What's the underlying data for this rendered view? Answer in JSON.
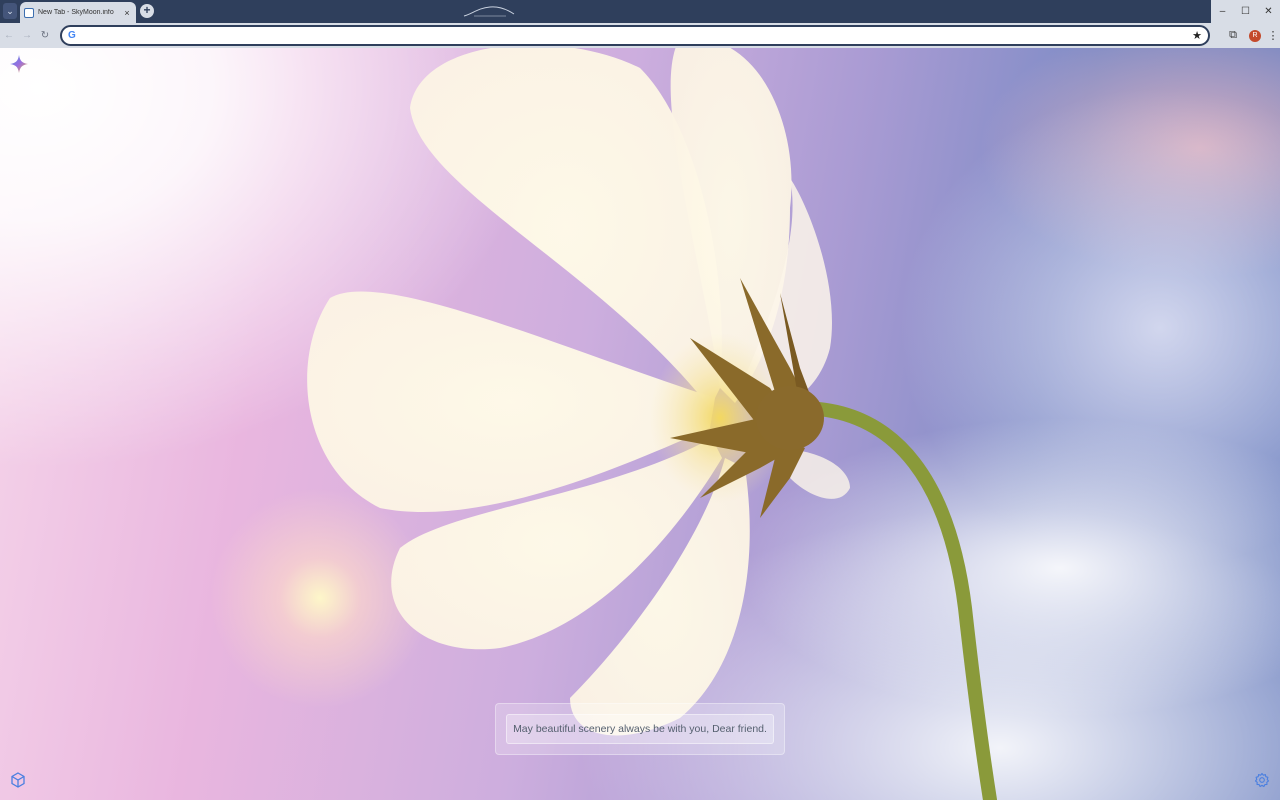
{
  "browser": {
    "tab": {
      "title": "New Tab - SkyMoon.info",
      "close": "×"
    },
    "new_tab": "+",
    "window_controls": {
      "minimize": "–",
      "maximize": "☐",
      "close": "✕"
    },
    "toolbar": {
      "back": "←",
      "forward": "→",
      "reload": "↻",
      "omnibox_value": "",
      "google_glyph": "G",
      "star": "★",
      "extensions": "⧉",
      "avatar_letter": "R",
      "menu": "⋮"
    },
    "tab_search": "⌄"
  },
  "page": {
    "quote": "May beautiful scenery always be with you, Dear friend."
  },
  "colors": {
    "frame": "#2f3f5c",
    "toolbar": "#d8dde6",
    "avatar": "#c44a2c",
    "accent_icon": "#4a7fe0"
  }
}
